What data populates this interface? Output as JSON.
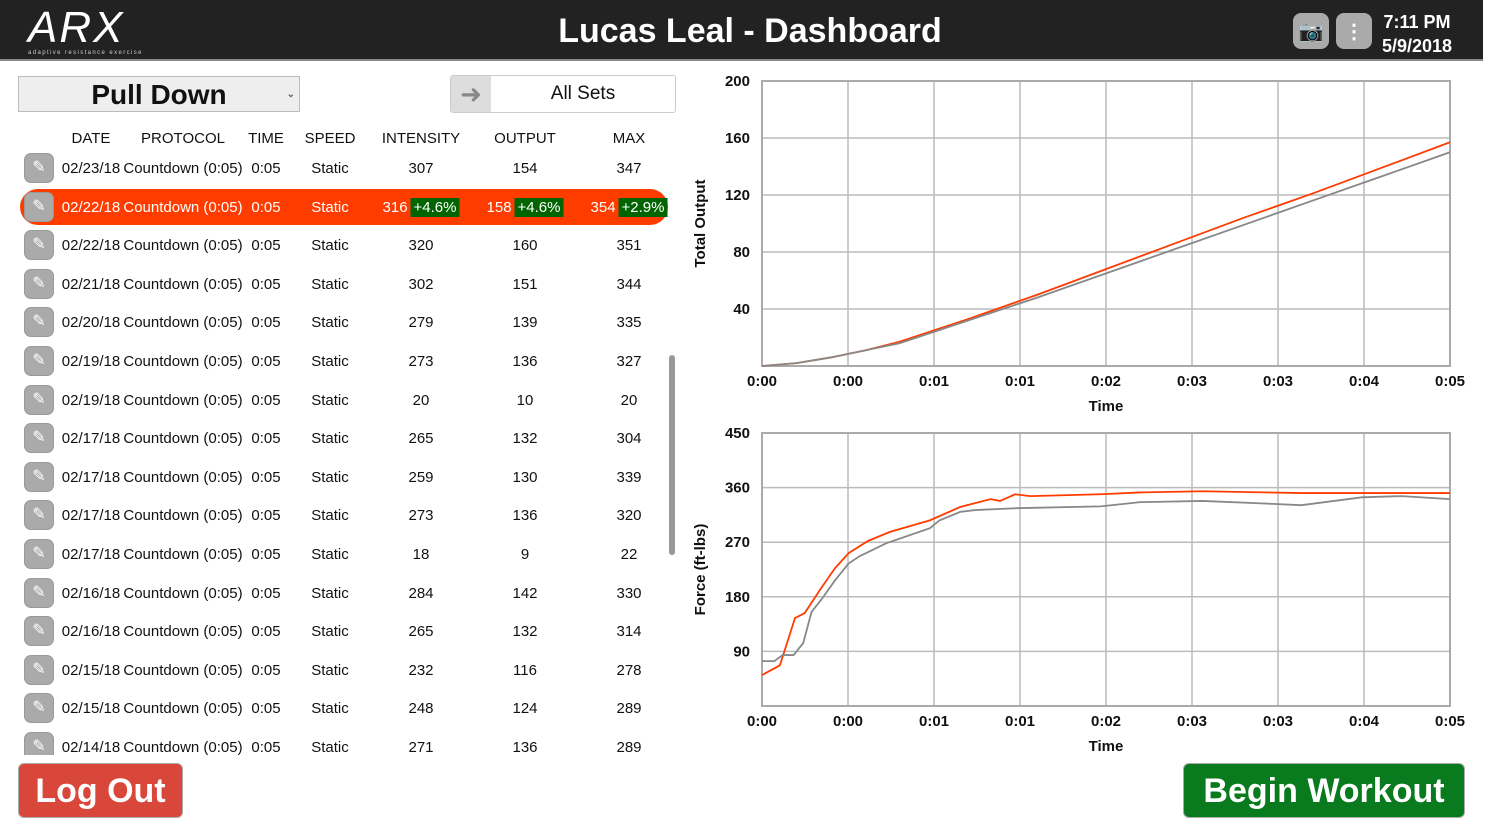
{
  "header": {
    "logo_text": "ARX",
    "logo_tagline": "adaptive resistance exercise",
    "title": "Lucas Leal - Dashboard",
    "time": "7:11 PM",
    "date": "5/9/2018",
    "camera_icon": "camera-icon",
    "menu_icon": "more-vertical-icon"
  },
  "exercise_select": {
    "value": "Pull Down"
  },
  "sets_filter": {
    "value": "All Sets",
    "icon": "arrow-right-icon"
  },
  "table": {
    "columns": [
      "DATE",
      "PROTOCOL",
      "TIME",
      "SPEED",
      "INTENSITY",
      "OUTPUT",
      "MAX"
    ],
    "rows": [
      {
        "date": "02/23/18",
        "protocol": "Countdown (0:05)",
        "time": "0:05",
        "speed": "Static",
        "intensity": "307",
        "output": "154",
        "max": "347"
      },
      {
        "date": "02/22/18",
        "protocol": "Countdown (0:05)",
        "time": "0:05",
        "speed": "Static",
        "intensity": "316",
        "output": "158",
        "max": "354",
        "selected": true,
        "intensity_change": "+4.6%",
        "output_change": "+4.6%",
        "max_change": "+2.9%"
      },
      {
        "date": "02/22/18",
        "protocol": "Countdown (0:05)",
        "time": "0:05",
        "speed": "Static",
        "intensity": "320",
        "output": "160",
        "max": "351"
      },
      {
        "date": "02/21/18",
        "protocol": "Countdown (0:05)",
        "time": "0:05",
        "speed": "Static",
        "intensity": "302",
        "output": "151",
        "max": "344"
      },
      {
        "date": "02/20/18",
        "protocol": "Countdown (0:05)",
        "time": "0:05",
        "speed": "Static",
        "intensity": "279",
        "output": "139",
        "max": "335"
      },
      {
        "date": "02/19/18",
        "protocol": "Countdown (0:05)",
        "time": "0:05",
        "speed": "Static",
        "intensity": "273",
        "output": "136",
        "max": "327"
      },
      {
        "date": "02/19/18",
        "protocol": "Countdown (0:05)",
        "time": "0:05",
        "speed": "Static",
        "intensity": "20",
        "output": "10",
        "max": "20"
      },
      {
        "date": "02/17/18",
        "protocol": "Countdown (0:05)",
        "time": "0:05",
        "speed": "Static",
        "intensity": "265",
        "output": "132",
        "max": "304"
      },
      {
        "date": "02/17/18",
        "protocol": "Countdown (0:05)",
        "time": "0:05",
        "speed": "Static",
        "intensity": "259",
        "output": "130",
        "max": "339"
      },
      {
        "date": "02/17/18",
        "protocol": "Countdown (0:05)",
        "time": "0:05",
        "speed": "Static",
        "intensity": "273",
        "output": "136",
        "max": "320"
      },
      {
        "date": "02/17/18",
        "protocol": "Countdown (0:05)",
        "time": "0:05",
        "speed": "Static",
        "intensity": "18",
        "output": "9",
        "max": "22"
      },
      {
        "date": "02/16/18",
        "protocol": "Countdown (0:05)",
        "time": "0:05",
        "speed": "Static",
        "intensity": "284",
        "output": "142",
        "max": "330"
      },
      {
        "date": "02/16/18",
        "protocol": "Countdown (0:05)",
        "time": "0:05",
        "speed": "Static",
        "intensity": "265",
        "output": "132",
        "max": "314"
      },
      {
        "date": "02/15/18",
        "protocol": "Countdown (0:05)",
        "time": "0:05",
        "speed": "Static",
        "intensity": "232",
        "output": "116",
        "max": "278"
      },
      {
        "date": "02/15/18",
        "protocol": "Countdown (0:05)",
        "time": "0:05",
        "speed": "Static",
        "intensity": "248",
        "output": "124",
        "max": "289"
      },
      {
        "date": "02/14/18",
        "protocol": "Countdown (0:05)",
        "time": "0:05",
        "speed": "Static",
        "intensity": "271",
        "output": "136",
        "max": "289"
      }
    ]
  },
  "buttons": {
    "logout": "Log Out",
    "begin": "Begin Workout"
  },
  "colors": {
    "current": "#ff3c00",
    "previous": "#888888",
    "selected_row": "#ff3c00",
    "badge": "#006400"
  },
  "chart_data": [
    {
      "type": "line",
      "xlabel": "Time",
      "ylabel": "Total Output",
      "ylim": [
        0,
        200
      ],
      "yticks": [
        40,
        80,
        120,
        160,
        200
      ],
      "xlim": [
        0,
        5
      ],
      "xtick_labels": [
        "0:00",
        "0:00",
        "0:01",
        "0:01",
        "0:02",
        "0:03",
        "0:03",
        "0:04",
        "0:05"
      ],
      "grid": true,
      "series": [
        {
          "color": "#ff3c00",
          "x": [
            0,
            0.25,
            0.5,
            0.75,
            1,
            1.5,
            2,
            2.5,
            3,
            3.5,
            4,
            4.5,
            5
          ],
          "y": [
            0,
            2,
            6,
            11,
            17,
            33,
            50,
            68,
            86,
            104,
            121,
            139,
            157
          ]
        },
        {
          "color": "#888888",
          "x": [
            0,
            0.25,
            0.5,
            0.75,
            1,
            1.5,
            2,
            2.5,
            3,
            3.5,
            4,
            4.5,
            5
          ],
          "y": [
            0,
            2,
            6,
            11,
            16,
            32,
            48,
            65,
            82,
            99,
            116,
            133,
            150
          ]
        }
      ]
    },
    {
      "type": "line",
      "xlabel": "Time",
      "ylabel": "Force (ft-lbs)",
      "ylim": [
        0,
        450
      ],
      "yticks": [
        90,
        180,
        270,
        360,
        450
      ],
      "xlim": [
        0,
        5
      ],
      "xtick_labels": [
        "0:00",
        "0:00",
        "0:01",
        "0:01",
        "0:02",
        "0:03",
        "0:03",
        "0:04",
        "0:05"
      ],
      "grid": true,
      "series": [
        {
          "color": "#ff3c00",
          "x": [
            0,
            0.13,
            0.24,
            0.31,
            0.42,
            0.53,
            0.63,
            0.77,
            0.93,
            1.22,
            1.44,
            1.66,
            1.73,
            1.84,
            1.95,
            2.46,
            2.75,
            3.2,
            3.92,
            4.4,
            5
          ],
          "y": [
            51,
            67,
            145,
            153,
            191,
            227,
            252,
            272,
            287,
            306,
            328,
            341,
            338,
            349,
            346,
            349,
            352,
            354,
            351,
            351,
            351
          ]
        },
        {
          "color": "#888888",
          "x": [
            0,
            0.09,
            0.15,
            0.23,
            0.3,
            0.36,
            0.44,
            0.53,
            0.63,
            0.71,
            0.9,
            1.22,
            1.29,
            1.44,
            1.55,
            1.84,
            2.46,
            2.75,
            3.2,
            3.63,
            3.92,
            4.36,
            4.65,
            5
          ],
          "y": [
            74,
            74,
            84,
            84,
            104,
            155,
            178,
            207,
            235,
            247,
            268,
            293,
            306,
            320,
            323,
            326,
            329,
            336,
            338,
            334,
            331,
            344,
            346,
            341
          ]
        }
      ]
    }
  ]
}
